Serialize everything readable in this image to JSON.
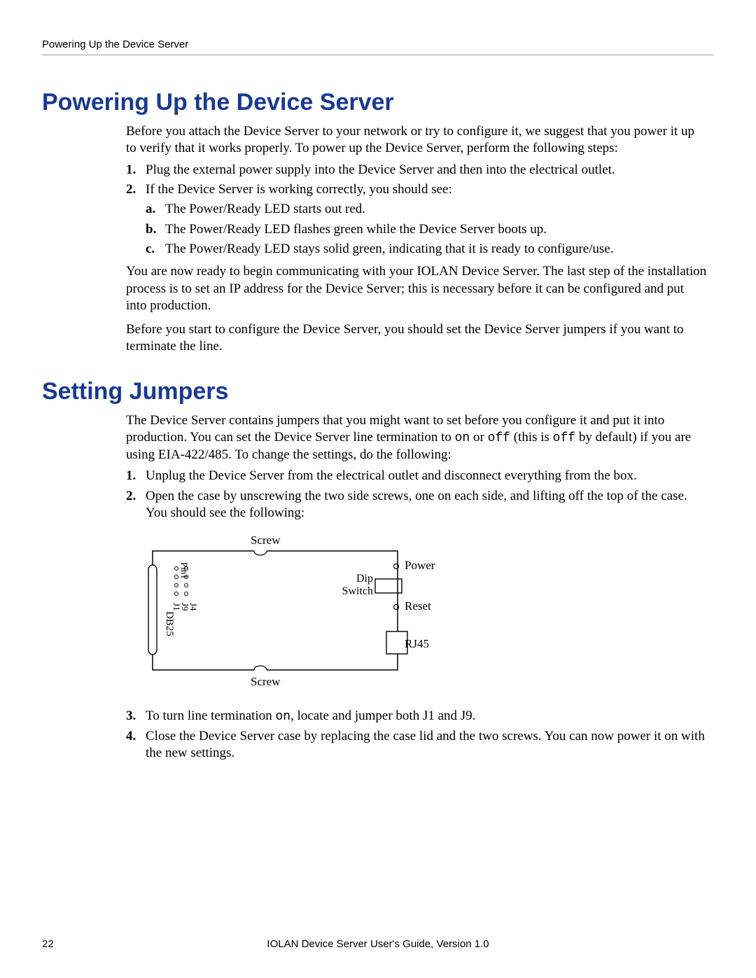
{
  "running_head": "Powering Up the Device Server",
  "section1": {
    "title": "Powering Up the Device Server",
    "intro": "Before you attach the Device Server to your network or try to configure it, we suggest that you power it up to verify that it works properly. To power up the Device Server, perform the following steps:",
    "step1": "Plug the external power supply into the Device Server and then into the electrical outlet.",
    "step2": "If the Device Server is working correctly, you should see:",
    "step2a": "The Power/Ready LED starts out red.",
    "step2b": "The Power/Ready LED flashes green while the Device Server boots up.",
    "step2c": "The Power/Ready LED stays solid green, indicating that it is ready to configure/use.",
    "outro1": "You are now ready to begin communicating with your IOLAN Device Server. The last step of the installation process is to set an IP address for the Device Server; this is necessary before it can be configured and put into production.",
    "outro2": "Before you start to configure the Device Server, you should set the Device Server jumpers if you want to terminate the line."
  },
  "section2": {
    "title": "Setting Jumpers",
    "intro_a": "The Device Server contains jumpers that you might want to set before you configure it and put it into production. You can set the Device Server line termination to ",
    "intro_on": "on",
    "intro_b": " or ",
    "intro_off1": "off",
    "intro_c": " (this is ",
    "intro_off2": "off",
    "intro_d": " by default) if you are using EIA-422/485. To change the settings, do the following:",
    "step1": "Unplug the Device Server from the electrical outlet and disconnect everything from the box.",
    "step2": "Open the case by unscrewing the two side screws, one on each side, and lifting off the top of the case. You should see the following:",
    "step3_a": "To turn line termination ",
    "step3_on": "on",
    "step3_b": ", locate and jumper both J1 and J9.",
    "step4": "Close the Device Server case by replacing the case lid and the two screws. You can now power it on with the new settings."
  },
  "diagram": {
    "screw_top": "Screw",
    "screw_bottom": "Screw",
    "db25": "DB25",
    "pin1": "Pin1",
    "j1": "J1",
    "j9": "J9",
    "j4": "J4",
    "dip": "Dip",
    "switch": "Switch",
    "power": "Power",
    "reset": "Reset",
    "rj45": "RJ45"
  },
  "footer": {
    "page": "22",
    "text": "IOLAN Device Server User's Guide, Version 1.0"
  },
  "list_markers": {
    "n1": "1.",
    "n2": "2.",
    "n3": "3.",
    "n4": "4.",
    "la": "a.",
    "lb": "b.",
    "lc": "c."
  }
}
